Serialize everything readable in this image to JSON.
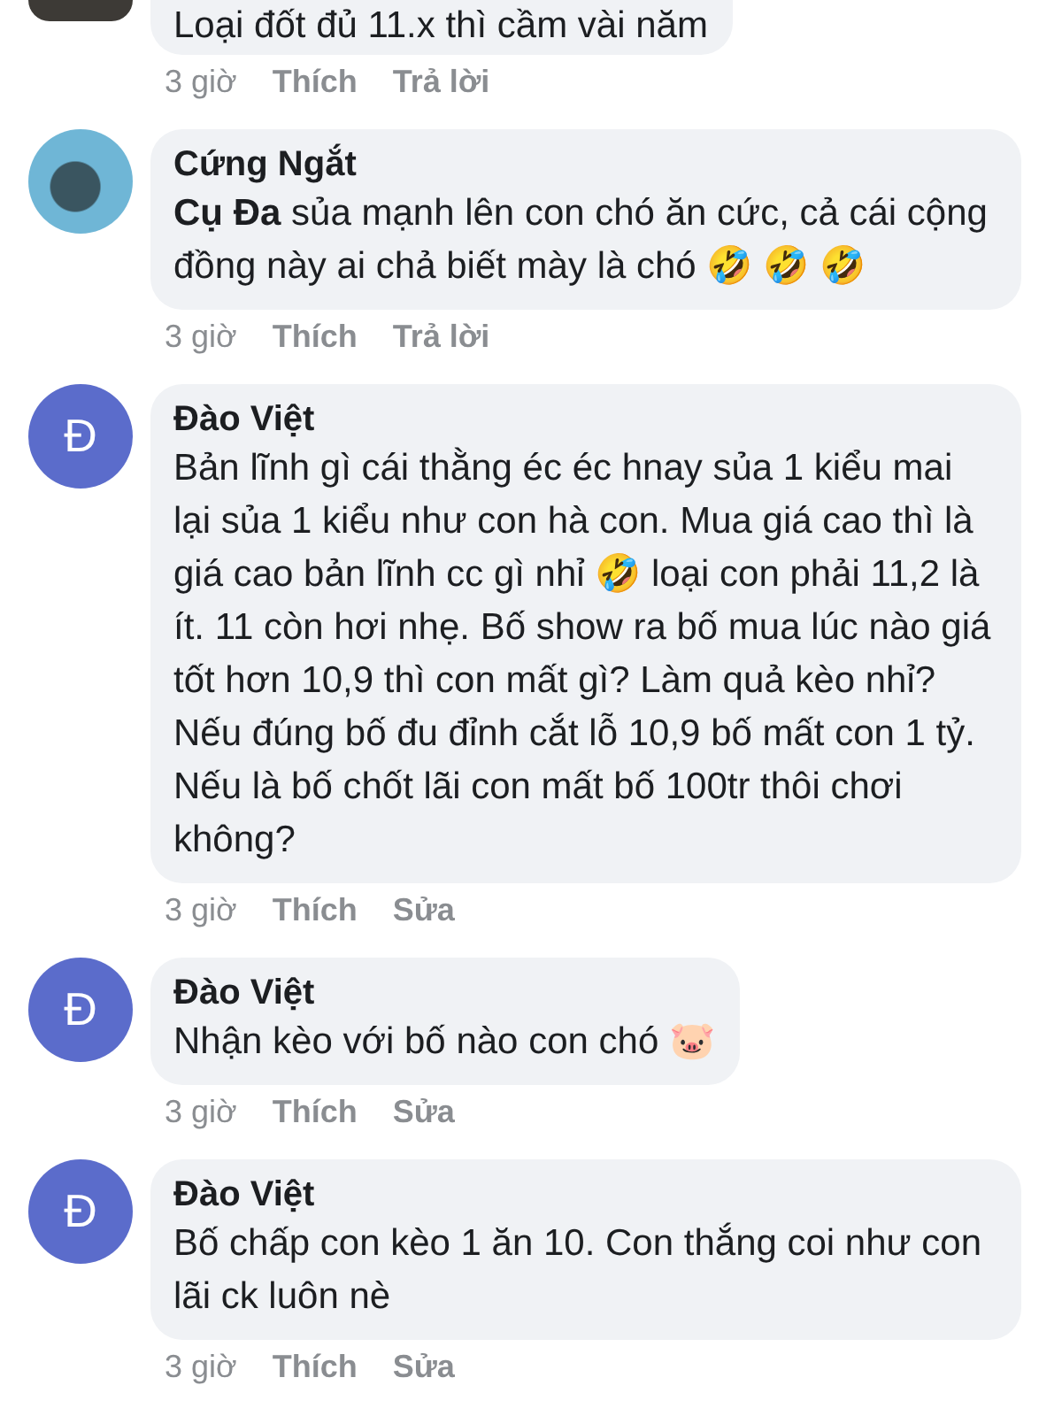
{
  "comments": [
    {
      "avatar": {
        "kind": "photo"
      },
      "body": "Loại đốt đủ 11.x thì cầm vài năm",
      "meta": {
        "time": "3 giờ",
        "like": "Thích",
        "action": "Trả lời"
      }
    },
    {
      "avatar": {
        "kind": "photo"
      },
      "author": "Cứng Ngắt",
      "body": "**Cụ Đa**  sủa mạnh lên con chó ăn cức, cả cái cộng đồng này ai chả biết mày là chó 🤣 🤣 🤣",
      "meta": {
        "time": "3 giờ",
        "like": "Thích",
        "action": "Trả lời"
      }
    },
    {
      "avatar": {
        "kind": "letter",
        "letter": "Đ",
        "color": "#5b6ccb"
      },
      "author": "Đào Việt",
      "body": "Bản lĩnh gì cái thằng éc éc hnay sủa 1 kiểu mai lại sủa 1 kiểu như con hà con. Mua giá cao thì là giá cao bản lĩnh cc gì nhỉ 🤣 loại con phải 11,2 là ít. 11 còn hơi nhẹ. Bố show ra bố mua lúc nào giá tốt hơn 10,9 thì con mất gì? Làm quả kèo nhỉ? Nếu đúng bố đu đỉnh cắt lỗ 10,9 bố mất con 1 tỷ. Nếu là bố chốt lãi con mất bố 100tr thôi chơi không?",
      "meta": {
        "time": "3 giờ",
        "like": "Thích",
        "action": "Sửa"
      }
    },
    {
      "avatar": {
        "kind": "letter",
        "letter": "Đ",
        "color": "#5b6ccb"
      },
      "author": "Đào Việt",
      "body": "Nhận kèo với bố nào con chó 🐷",
      "meta": {
        "time": "3 giờ",
        "like": "Thích",
        "action": "Sửa"
      }
    },
    {
      "avatar": {
        "kind": "letter",
        "letter": "Đ",
        "color": "#5b6ccb"
      },
      "author": "Đào Việt",
      "body": "Bố chấp con kèo 1 ăn 10. Con thắng coi như con lãi ck luôn nè",
      "meta": {
        "time": "3 giờ",
        "like": "Thích",
        "action": "Sửa"
      }
    }
  ]
}
